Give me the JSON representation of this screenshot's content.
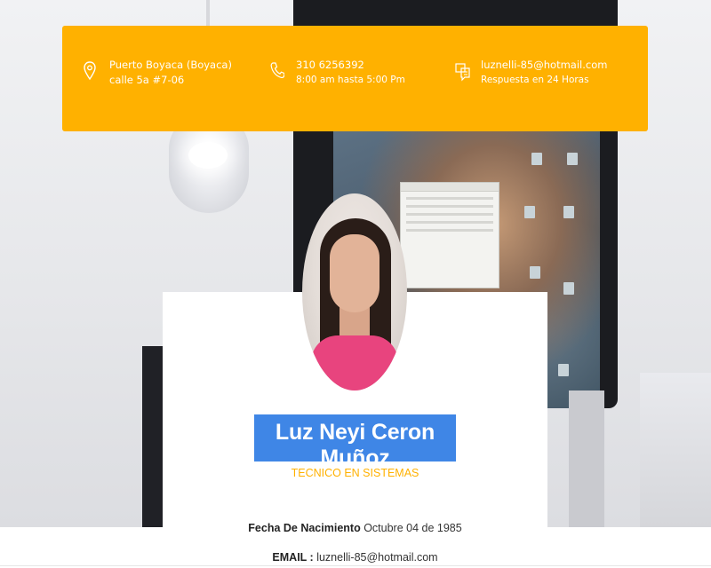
{
  "contact": {
    "location": {
      "icon": "map-pin-icon",
      "line1": "Puerto Boyaca (Boyaca)",
      "line2": "calle 5a #7-06"
    },
    "phone": {
      "icon": "phone-icon",
      "line1": "310 6256392",
      "line2": "8:00 am hasta 5:00 Pm"
    },
    "email": {
      "icon": "chat-icon",
      "line1": "luznelli-85@hotmail.com",
      "line2": "Respuesta en 24 Horas"
    },
    "bar_color": "#ffb100"
  },
  "profile": {
    "name": "Luz Neyi Ceron Muñoz",
    "role": "TECNICO EN SISTEMAS",
    "birth_label": "Fecha De Nacimiento",
    "birth_value": "Octubre 04 de 1985",
    "email_label": "EMAIL :",
    "email_value": "luznelli-85@hotmail.com",
    "selection_color": "#3f86e6",
    "accent_color": "#ffb100"
  }
}
